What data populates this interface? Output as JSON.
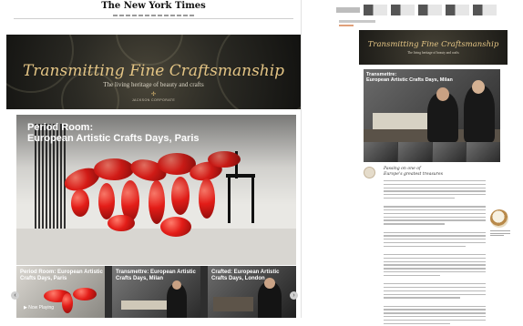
{
  "left": {
    "masthead": "The New York Times",
    "hero": {
      "title": "Transmitting Fine Craftsmanship",
      "subtitle": "The living heritage of beauty and crafts",
      "brand_mark": "✣",
      "brand": "JACKSON CORPORATE"
    },
    "main_video": {
      "headline_line1": "Period Room:",
      "headline_line2": "European Artistic Crafts Days, Paris"
    },
    "thumbnails": [
      {
        "label": "Period Room: European Artistic Crafts Days, Paris",
        "status": "▶ Now Playing"
      },
      {
        "label": "Transmettre: European Artistic Crafts Days, Milan"
      },
      {
        "label": "Crafted: European Artistic Crafts Days, London"
      }
    ],
    "arrows": {
      "prev": "‹",
      "next": "›"
    }
  },
  "right": {
    "hero": {
      "title": "Transmitting Fine Craftsmanship",
      "subtitle": "The living heritage of beauty and crafts"
    },
    "video": {
      "headline_line1": "Transmettre:",
      "headline_line2": "European Artistic Crafts Days, Milan"
    },
    "article": {
      "headline_line1": "Passing on one of",
      "headline_line2": "Europe's greatest treasures"
    }
  },
  "colors": {
    "gold": "#e4c585",
    "balloon_red": "#e31d18",
    "dark_strip": "#2e2e2e"
  }
}
